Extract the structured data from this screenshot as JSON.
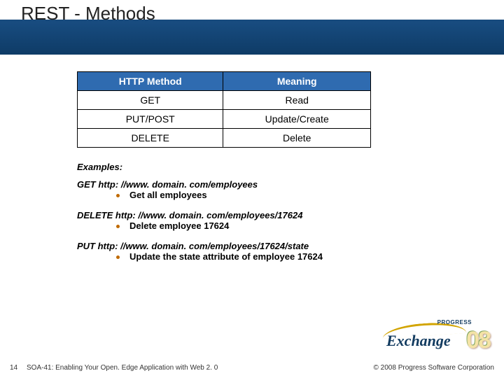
{
  "slide": {
    "title": "REST - Methods",
    "table": {
      "headers": [
        "HTTP Method",
        "Meaning"
      ],
      "rows": [
        {
          "method": "GET",
          "meaning": "Read"
        },
        {
          "method": "PUT/POST",
          "meaning": "Update/Create"
        },
        {
          "method": "DELETE",
          "meaning": "Delete"
        }
      ]
    },
    "examples_label": "Examples:",
    "examples": [
      {
        "request": "GET http: //www. domain. com/employees",
        "description": "Get all employees"
      },
      {
        "request": "DELETE http: //www. domain. com/employees/17624",
        "description": "Delete employee 17624"
      },
      {
        "request": "PUT http: //www. domain. com/employees/17624/state",
        "description": "Update the state attribute of employee 17624"
      }
    ]
  },
  "footer": {
    "page": "14",
    "title": "SOA-41: Enabling Your Open. Edge Application with Web 2. 0",
    "copyright": "© 2008 Progress Software Corporation"
  },
  "logo": {
    "brand": "PROGRESS",
    "product": "Exchange",
    "year": "08"
  },
  "chart_data": {
    "type": "table",
    "title": "REST - Methods",
    "columns": [
      "HTTP Method",
      "Meaning"
    ],
    "rows": [
      [
        "GET",
        "Read"
      ],
      [
        "PUT/POST",
        "Update/Create"
      ],
      [
        "DELETE",
        "Delete"
      ]
    ]
  }
}
